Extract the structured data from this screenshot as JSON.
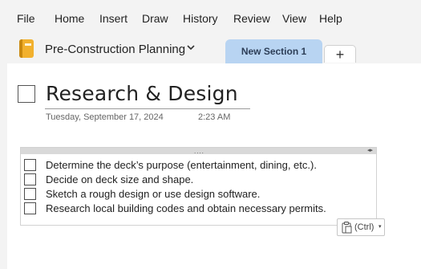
{
  "menu": {
    "items": [
      "File",
      "Home",
      "Insert",
      "Draw",
      "History",
      "Review",
      "View",
      "Help"
    ]
  },
  "notebook": {
    "name": "Pre-Construction Planning",
    "icon": "notebook-icon",
    "icon_color": "#f2b12e"
  },
  "sections": {
    "active_tab": "New Section 1",
    "add_tab_label": "+",
    "active_tab_color": "#b8d4f2"
  },
  "page": {
    "title": "Research & Design",
    "date": "Tuesday, September 17, 2024",
    "time": "2:23 AM"
  },
  "container": {
    "handle_dots": "....",
    "resize_arrows": "◂▸",
    "todos": [
      {
        "text": "Determine the deck’s purpose (entertainment, dining, etc.).",
        "checked": false
      },
      {
        "text": "Decide on deck size and shape.",
        "checked": false
      },
      {
        "text": "Sketch a rough design or use design software.",
        "checked": false
      },
      {
        "text": "Research local building codes and obtain necessary permits.",
        "checked": false
      }
    ]
  },
  "paste_options": {
    "label": "(Ctrl)",
    "caret": "▾",
    "icon": "clipboard-icon"
  }
}
